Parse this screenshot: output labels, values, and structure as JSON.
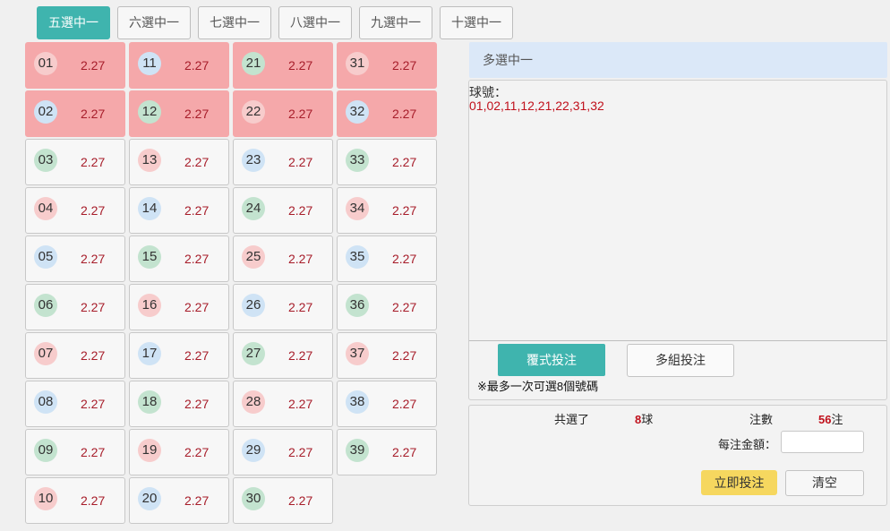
{
  "tabs": [
    {
      "label": "五選中一",
      "active": true
    },
    {
      "label": "六選中一",
      "active": false
    },
    {
      "label": "七選中一",
      "active": false
    },
    {
      "label": "八選中一",
      "active": false
    },
    {
      "label": "九選中一",
      "active": false
    },
    {
      "label": "十選中一",
      "active": false
    }
  ],
  "numbers": [
    {
      "num": "01",
      "odds": "2.27",
      "color": "red",
      "selected": true
    },
    {
      "num": "02",
      "odds": "2.27",
      "color": "blue",
      "selected": true
    },
    {
      "num": "03",
      "odds": "2.27",
      "color": "green",
      "selected": false
    },
    {
      "num": "04",
      "odds": "2.27",
      "color": "red",
      "selected": false
    },
    {
      "num": "05",
      "odds": "2.27",
      "color": "blue",
      "selected": false
    },
    {
      "num": "06",
      "odds": "2.27",
      "color": "green",
      "selected": false
    },
    {
      "num": "07",
      "odds": "2.27",
      "color": "red",
      "selected": false
    },
    {
      "num": "08",
      "odds": "2.27",
      "color": "blue",
      "selected": false
    },
    {
      "num": "09",
      "odds": "2.27",
      "color": "green",
      "selected": false
    },
    {
      "num": "10",
      "odds": "2.27",
      "color": "red",
      "selected": false
    },
    {
      "num": "11",
      "odds": "2.27",
      "color": "blue",
      "selected": true
    },
    {
      "num": "12",
      "odds": "2.27",
      "color": "green",
      "selected": true
    },
    {
      "num": "13",
      "odds": "2.27",
      "color": "red",
      "selected": false
    },
    {
      "num": "14",
      "odds": "2.27",
      "color": "blue",
      "selected": false
    },
    {
      "num": "15",
      "odds": "2.27",
      "color": "green",
      "selected": false
    },
    {
      "num": "16",
      "odds": "2.27",
      "color": "red",
      "selected": false
    },
    {
      "num": "17",
      "odds": "2.27",
      "color": "blue",
      "selected": false
    },
    {
      "num": "18",
      "odds": "2.27",
      "color": "green",
      "selected": false
    },
    {
      "num": "19",
      "odds": "2.27",
      "color": "red",
      "selected": false
    },
    {
      "num": "20",
      "odds": "2.27",
      "color": "blue",
      "selected": false
    },
    {
      "num": "21",
      "odds": "2.27",
      "color": "green",
      "selected": true
    },
    {
      "num": "22",
      "odds": "2.27",
      "color": "red",
      "selected": true
    },
    {
      "num": "23",
      "odds": "2.27",
      "color": "blue",
      "selected": false
    },
    {
      "num": "24",
      "odds": "2.27",
      "color": "green",
      "selected": false
    },
    {
      "num": "25",
      "odds": "2.27",
      "color": "red",
      "selected": false
    },
    {
      "num": "26",
      "odds": "2.27",
      "color": "blue",
      "selected": false
    },
    {
      "num": "27",
      "odds": "2.27",
      "color": "green",
      "selected": false
    },
    {
      "num": "28",
      "odds": "2.27",
      "color": "red",
      "selected": false
    },
    {
      "num": "29",
      "odds": "2.27",
      "color": "blue",
      "selected": false
    },
    {
      "num": "30",
      "odds": "2.27",
      "color": "green",
      "selected": false
    },
    {
      "num": "31",
      "odds": "2.27",
      "color": "red",
      "selected": true
    },
    {
      "num": "32",
      "odds": "2.27",
      "color": "blue",
      "selected": true
    },
    {
      "num": "33",
      "odds": "2.27",
      "color": "green",
      "selected": false
    },
    {
      "num": "34",
      "odds": "2.27",
      "color": "red",
      "selected": false
    },
    {
      "num": "35",
      "odds": "2.27",
      "color": "blue",
      "selected": false
    },
    {
      "num": "36",
      "odds": "2.27",
      "color": "green",
      "selected": false
    },
    {
      "num": "37",
      "odds": "2.27",
      "color": "red",
      "selected": false
    },
    {
      "num": "38",
      "odds": "2.27",
      "color": "blue",
      "selected": false
    },
    {
      "num": "39",
      "odds": "2.27",
      "color": "green",
      "selected": false
    }
  ],
  "panel": {
    "title": "多選中一",
    "balls_label": "球號：",
    "balls_list": "01,02,11,12,21,22,31,32",
    "multi_bet_button": "覆式投注",
    "group_bet_button": "多組投注",
    "note": "※最多一次可選8個號碼"
  },
  "summary": {
    "selected_label": "共選了",
    "selected_count": "8",
    "selected_unit": "球",
    "bets_label": "注數",
    "bets_count": "56",
    "bets_unit": "注",
    "amount_label": "每注金額：",
    "amount_value": "",
    "submit_button": "立即投注",
    "clear_button": "清空"
  },
  "colors": {
    "accent": "#3fb4ae",
    "selected_cell": "#f5a8aa",
    "ball_red": "#f7cccc",
    "ball_blue": "#cfe3f5",
    "ball_green": "#c3e3cf",
    "odds_text": "#a71d2a",
    "highlight_text": "#c0101b",
    "submit_button": "#f6d75f"
  }
}
